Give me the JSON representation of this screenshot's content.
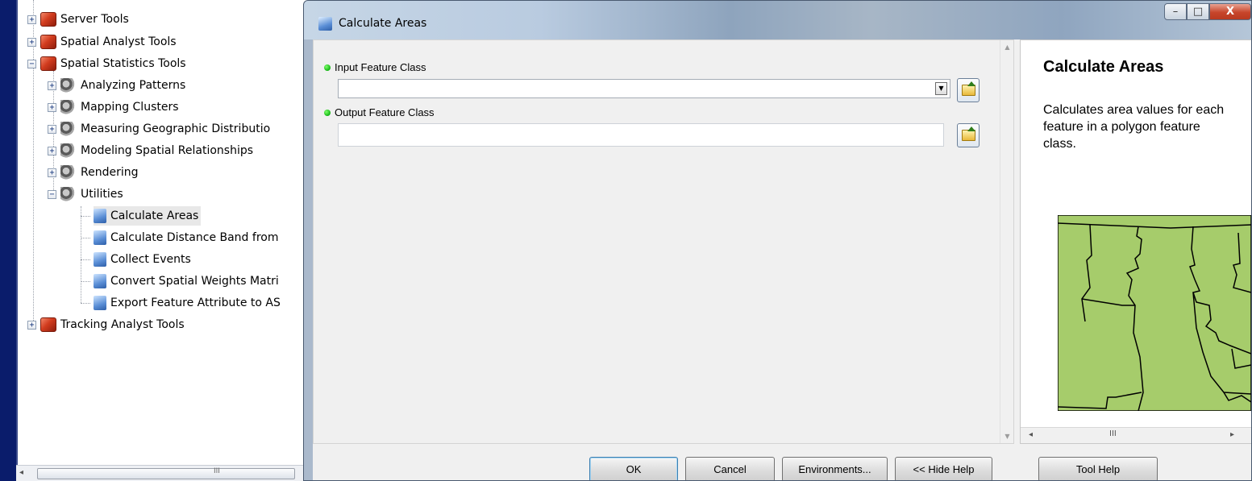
{
  "catalog_tree": {
    "items": [
      {
        "label": "Server Tools",
        "type": "toolbox",
        "expander": "+",
        "level": 0
      },
      {
        "label": "Spatial Analyst Tools",
        "type": "toolbox",
        "expander": "+",
        "level": 0
      },
      {
        "label": "Spatial Statistics Tools",
        "type": "toolbox",
        "expander": "-",
        "level": 0
      },
      {
        "label": "Analyzing Patterns",
        "type": "toolset",
        "expander": "+",
        "level": 1
      },
      {
        "label": "Mapping Clusters",
        "type": "toolset",
        "expander": "+",
        "level": 1
      },
      {
        "label": "Measuring Geographic Distributio",
        "type": "toolset",
        "expander": "+",
        "level": 1
      },
      {
        "label": "Modeling Spatial Relationships",
        "type": "toolset",
        "expander": "+",
        "level": 1
      },
      {
        "label": "Rendering",
        "type": "toolset",
        "expander": "+",
        "level": 1
      },
      {
        "label": "Utilities",
        "type": "toolset",
        "expander": "-",
        "level": 1
      },
      {
        "label": "Calculate Areas",
        "type": "script",
        "expander": "",
        "level": 2
      },
      {
        "label": "Calculate Distance Band from",
        "type": "script",
        "expander": "",
        "level": 2
      },
      {
        "label": "Collect Events",
        "type": "script",
        "expander": "",
        "level": 2
      },
      {
        "label": "Convert Spatial Weights Matri",
        "type": "script",
        "expander": "",
        "level": 2
      },
      {
        "label": "Export Feature Attribute to AS",
        "type": "script",
        "expander": "",
        "level": 2
      },
      {
        "label": "Tracking Analyst Tools",
        "type": "toolbox",
        "expander": "+",
        "level": 0
      }
    ],
    "hscroll_glyph": "III"
  },
  "dialog": {
    "title": "Calculate Areas",
    "window_buttons": {
      "minimize": "–",
      "maximize": "□",
      "close": "X"
    },
    "params": {
      "input_label": "Input Feature Class",
      "input_value": "",
      "output_label": "Output Feature Class",
      "output_value": ""
    },
    "help": {
      "title": "Calculate Areas",
      "description": "Calculates area values for each feature in a polygon feature class.",
      "hscroll_glyph": "III"
    },
    "buttons": {
      "ok": "OK",
      "cancel": "Cancel",
      "environments": "Environments...",
      "hide_help": "<< Hide Help",
      "tool_help": "Tool Help"
    }
  },
  "colors": {
    "desktop_bg": "#0a1c6b",
    "required_dot": "#12b313",
    "map_fill": "#a6cc6b",
    "window_close": "#c7452b"
  },
  "icons": [
    "toolbox-icon",
    "toolset-icon",
    "script-tool-icon",
    "browse-folder-icon",
    "dropdown-arrow-icon"
  ]
}
